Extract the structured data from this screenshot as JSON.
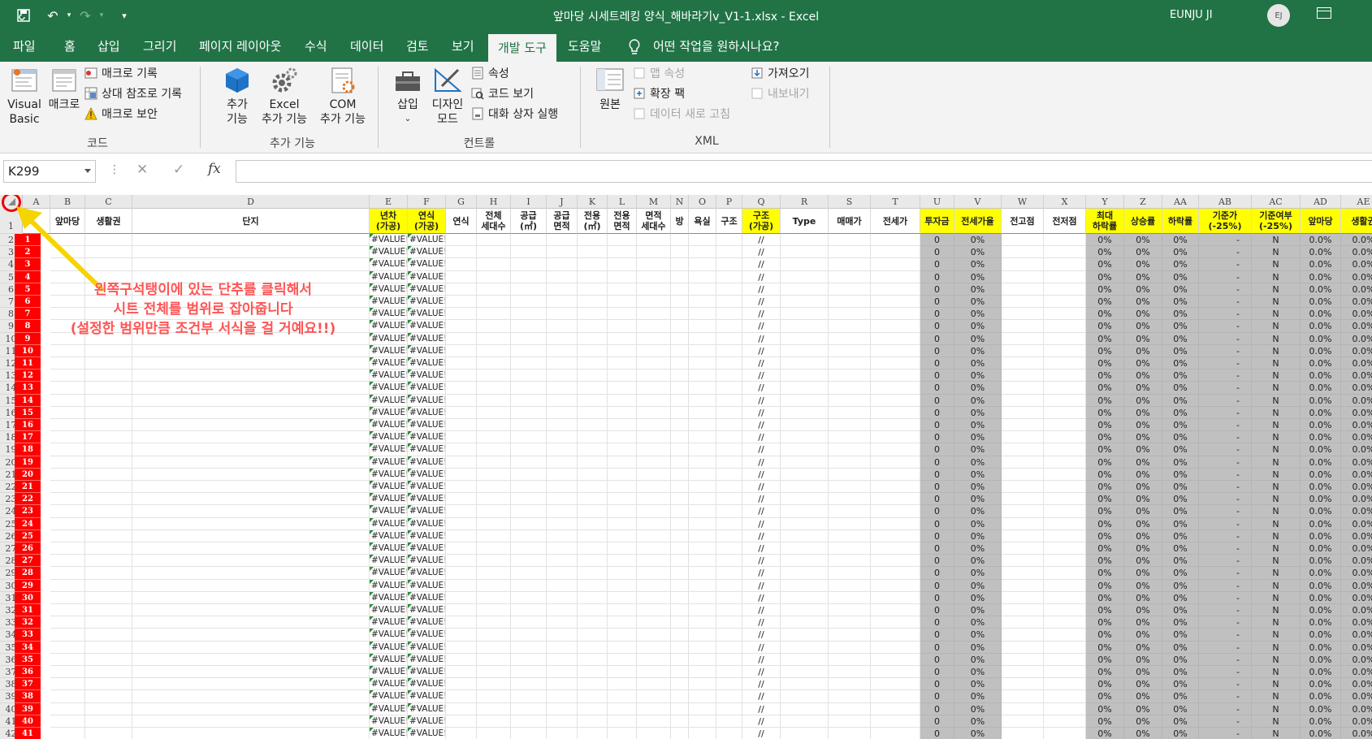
{
  "titlebar": {
    "title": "앞마당 시세트레킹 양식_해바라기v_V1-1.xlsx  -  Excel",
    "user": "EUNJU JI",
    "avatar_initials": "EJ",
    "quick_access": [
      "save-icon",
      "undo-icon",
      "redo-icon",
      "customize-icon"
    ]
  },
  "tabs": {
    "file": "파일",
    "home": "홈",
    "insert": "삽입",
    "draw": "그리기",
    "page_layout": "페이지 레이아웃",
    "formulas": "수식",
    "data": "데이터",
    "review": "검토",
    "view": "보기",
    "developer": "개발 도구",
    "help": "도움말",
    "tell_me": "어떤 작업을 원하시나요?"
  },
  "ribbon": {
    "code": {
      "label": "코드",
      "visual_basic_1": "Visual",
      "visual_basic_2": "Basic",
      "macros": "매크로",
      "record_macro": "매크로 기록",
      "relative_ref": "상대 참조로 기록",
      "macro_security": "매크로 보안"
    },
    "addins": {
      "label": "추가 기능",
      "addins_1": "추가",
      "addins_2": "기능",
      "excel_addins_1": "Excel",
      "excel_addins_2": "추가 기능",
      "com_addins_1": "COM",
      "com_addins_2": "추가 기능"
    },
    "controls": {
      "label": "컨트롤",
      "insert": "삽입",
      "design_mode_1": "디자인",
      "design_mode_2": "모드",
      "properties": "속성",
      "view_code": "코드 보기",
      "run_dialog": "대화 상자 실행"
    },
    "xml": {
      "label": "XML",
      "source": "원본",
      "map_properties": "맵 속성",
      "expansion_packs": "확장 팩",
      "refresh_data": "데이터 새로 고침",
      "import": "가져오기",
      "export": "내보내기"
    }
  },
  "formula_bar": {
    "name_box": "K299",
    "fx": "fx",
    "value": ""
  },
  "sheet": {
    "columns": [
      "A",
      "B",
      "C",
      "D",
      "E",
      "F",
      "G",
      "H",
      "I",
      "J",
      "K",
      "L",
      "M",
      "N",
      "O",
      "P",
      "Q",
      "R",
      "S",
      "T",
      "U",
      "V",
      "W",
      "X",
      "Y",
      "Z",
      "AA",
      "AB",
      "AC",
      "AD",
      "AE"
    ],
    "headers": {
      "A": "",
      "B": "앞마당",
      "C": "생활권",
      "D": "단지",
      "E": "년차\n(가공)",
      "F": "연식\n(가공)",
      "G": "연식",
      "H": "전체\n세대수",
      "I": "공급\n(㎡)",
      "J": "공급\n면적",
      "K": "전용\n(㎡)",
      "L": "전용\n면적",
      "M": "면적\n세대수",
      "N": "방",
      "O": "욕실",
      "P": "구조",
      "Q": "구조\n(가공)",
      "R": "Type",
      "S": "매매가",
      "T": "전세가",
      "U": "투자금",
      "V": "전세가율",
      "W": "전고점",
      "X": "전저점",
      "Y": "최대\n하락률",
      "Z": "상승률",
      "AA": "하락률",
      "AB": "기준가\n(-25%)",
      "AC": "기준여부\n(-25%)",
      "AD": "앞마당",
      "AE": "생활권"
    },
    "row_numbers": [
      1,
      2,
      3,
      4,
      5,
      6,
      7,
      8,
      9,
      10,
      11,
      12,
      13,
      14,
      15,
      16,
      17,
      18,
      19,
      20,
      21,
      22,
      23,
      24,
      25,
      26,
      27,
      28,
      29,
      30,
      31,
      32,
      33,
      34,
      35,
      36,
      37,
      38,
      39,
      40,
      41,
      42
    ],
    "a_values": [
      1,
      2,
      3,
      4,
      5,
      6,
      7,
      8,
      9,
      10,
      11,
      12,
      13,
      14,
      15,
      16,
      17,
      18,
      19,
      20,
      21,
      22,
      23,
      24,
      25,
      26,
      27,
      28,
      29,
      30,
      31,
      32,
      33,
      34,
      35,
      36,
      37,
      38,
      39,
      40,
      41
    ],
    "row_template": {
      "E": "#VALUE!",
      "F": "#VALUE!",
      "Q": "//",
      "U": "0",
      "V": "0%",
      "Y": "0%",
      "Z": "0%",
      "AA": "0%",
      "AB": "-",
      "AC": "N",
      "AD": "0.0%",
      "AE": "0.0%"
    }
  },
  "annotation": {
    "line1": "왼쪽구석탱이에 있는 단추를 클릭해서",
    "line2": "시트 전체를 범위로 잡아줍니다",
    "line3": "(설정한 범위만큼 조건부 서식을 걸 거예요!!)",
    "color": "#ff5555"
  },
  "colors": {
    "excel_green": "#217346",
    "highlight_yellow": "#ffff00",
    "gray_fill": "#c0c0c0",
    "row_red": "#ff0000",
    "arrow_yellow": "#f5d400"
  }
}
